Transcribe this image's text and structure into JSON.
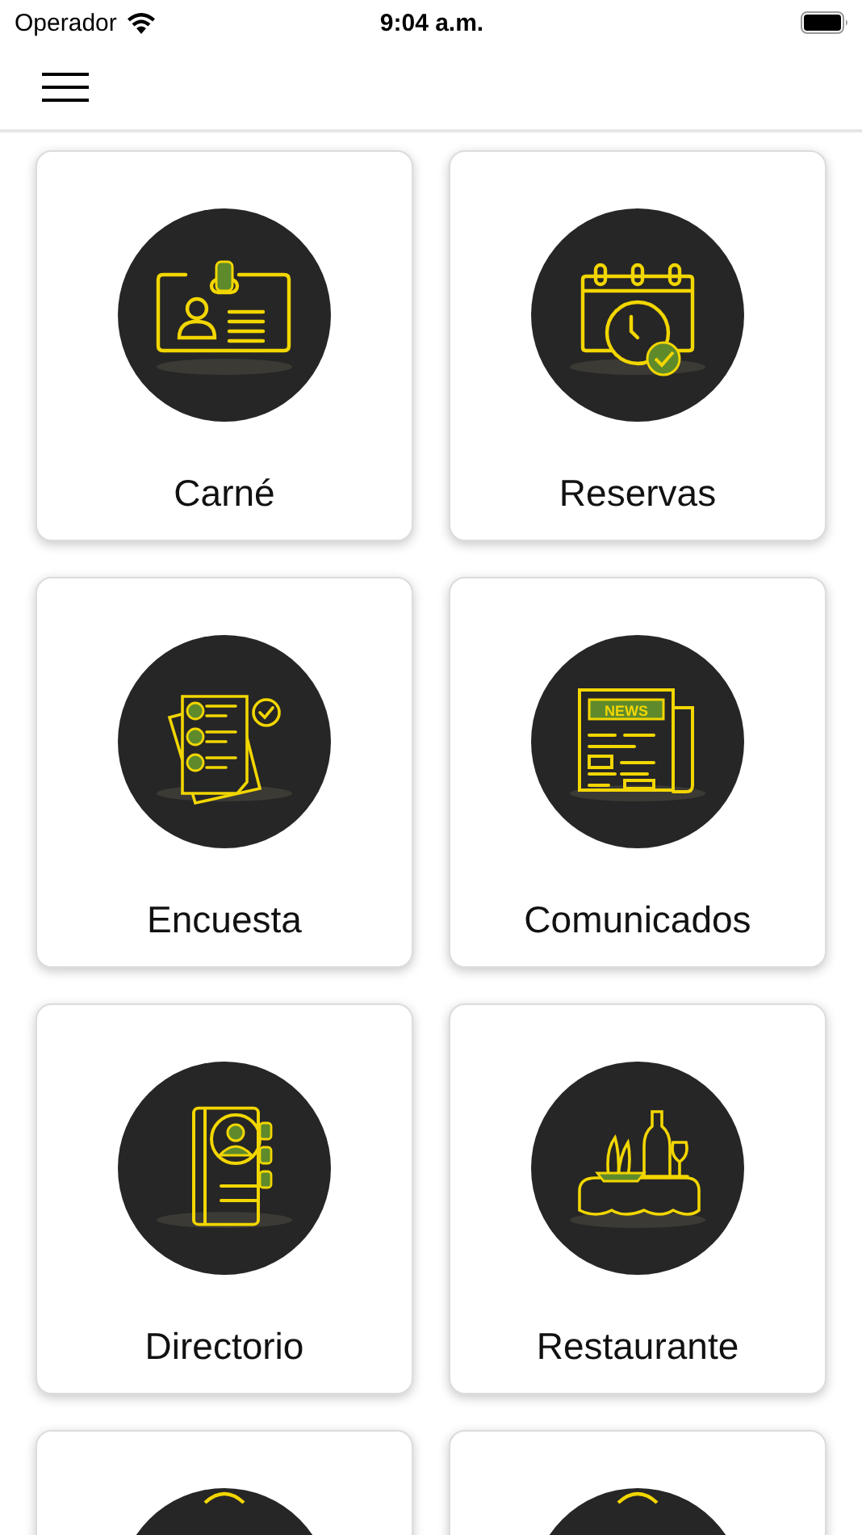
{
  "status_bar": {
    "carrier": "Operador",
    "time": "9:04 a.m."
  },
  "tile_rows": [
    {
      "tiles": [
        {
          "kind": "id-card",
          "label": "Carné"
        },
        {
          "kind": "calendar",
          "label": "Reservas"
        }
      ]
    },
    {
      "tiles": [
        {
          "kind": "survey",
          "label": "Encuesta"
        },
        {
          "kind": "news",
          "label": "Comunicados",
          "badge_text": "NEWS"
        }
      ]
    },
    {
      "tiles": [
        {
          "kind": "directory",
          "label": "Directorio"
        },
        {
          "kind": "restaurant",
          "label": "Restaurante"
        }
      ]
    },
    {
      "tiles": [
        {
          "kind": "partial"
        },
        {
          "kind": "partial"
        }
      ]
    }
  ]
}
